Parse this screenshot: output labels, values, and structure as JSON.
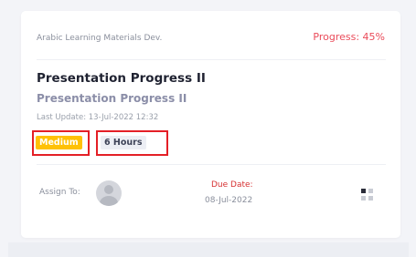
{
  "card": {
    "project": "Arabic Learning Materials Dev.",
    "progress": "Progress: 45%",
    "title": "Presentation Progress II",
    "subtitle": "Presentation Progress II",
    "last_update": "Last Update: 13-Jul-2022 12:32",
    "priority_badge": "Medium",
    "hours_badge": "6 Hours",
    "assign_label": "Assign To:",
    "due_label": "Due Date:",
    "due_date": "08-Jul-2022",
    "menu_icon": "grid-menu-icon"
  },
  "colors": {
    "progress": "#ea4b5a",
    "priority_badge_bg": "#ffc107",
    "hours_badge_bg": "#eceef4",
    "highlight_border": "#e41f26"
  }
}
